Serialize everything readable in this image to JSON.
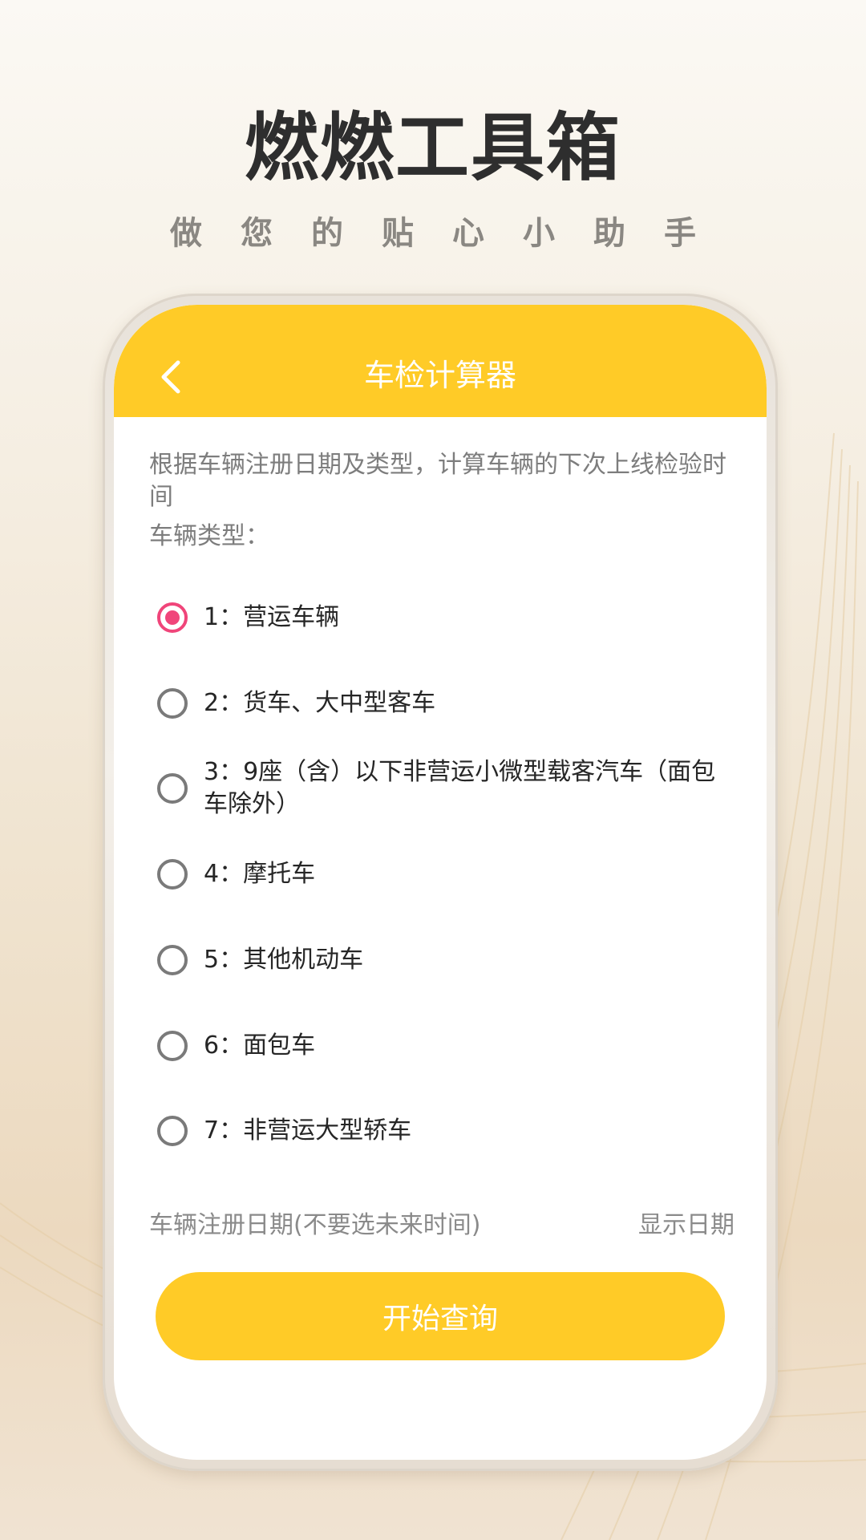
{
  "header": {
    "title": "燃燃工具箱",
    "subtitle": "做您的贴心小助手"
  },
  "toolbar": {
    "back_icon": "chevron-left-icon",
    "title": "车检计算器"
  },
  "colors": {
    "accent": "#ffcb27",
    "radio_selected": "#f0457a",
    "radio_unselected": "#7a7a7a"
  },
  "main": {
    "description": "根据车辆注册日期及类型，计算车辆的下次上线检验时间",
    "type_label": "车辆类型：",
    "selected_option": "1：营运车辆",
    "options": [
      {
        "label": "1：营运车辆",
        "checked": true
      },
      {
        "label": "2：货车、大中型客车",
        "checked": false
      },
      {
        "label": "3：9座（含）以下非营运小微型载客汽车（面包车除外）",
        "checked": false
      },
      {
        "label": "4：摩托车",
        "checked": false
      },
      {
        "label": "5：其他机动车",
        "checked": false
      },
      {
        "label": "6：面包车",
        "checked": false
      },
      {
        "label": "7：非营运大型轿车",
        "checked": false
      }
    ],
    "date_label": "车辆注册日期(不要选未来时间)",
    "date_value": "显示日期",
    "query_button": "开始查询"
  }
}
